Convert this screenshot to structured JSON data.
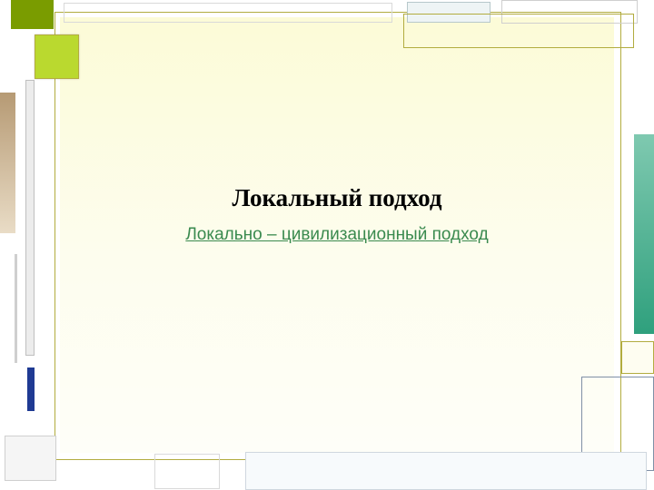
{
  "title": "Локальный подход",
  "subtitle": "Локально – цивилизационный подход"
}
